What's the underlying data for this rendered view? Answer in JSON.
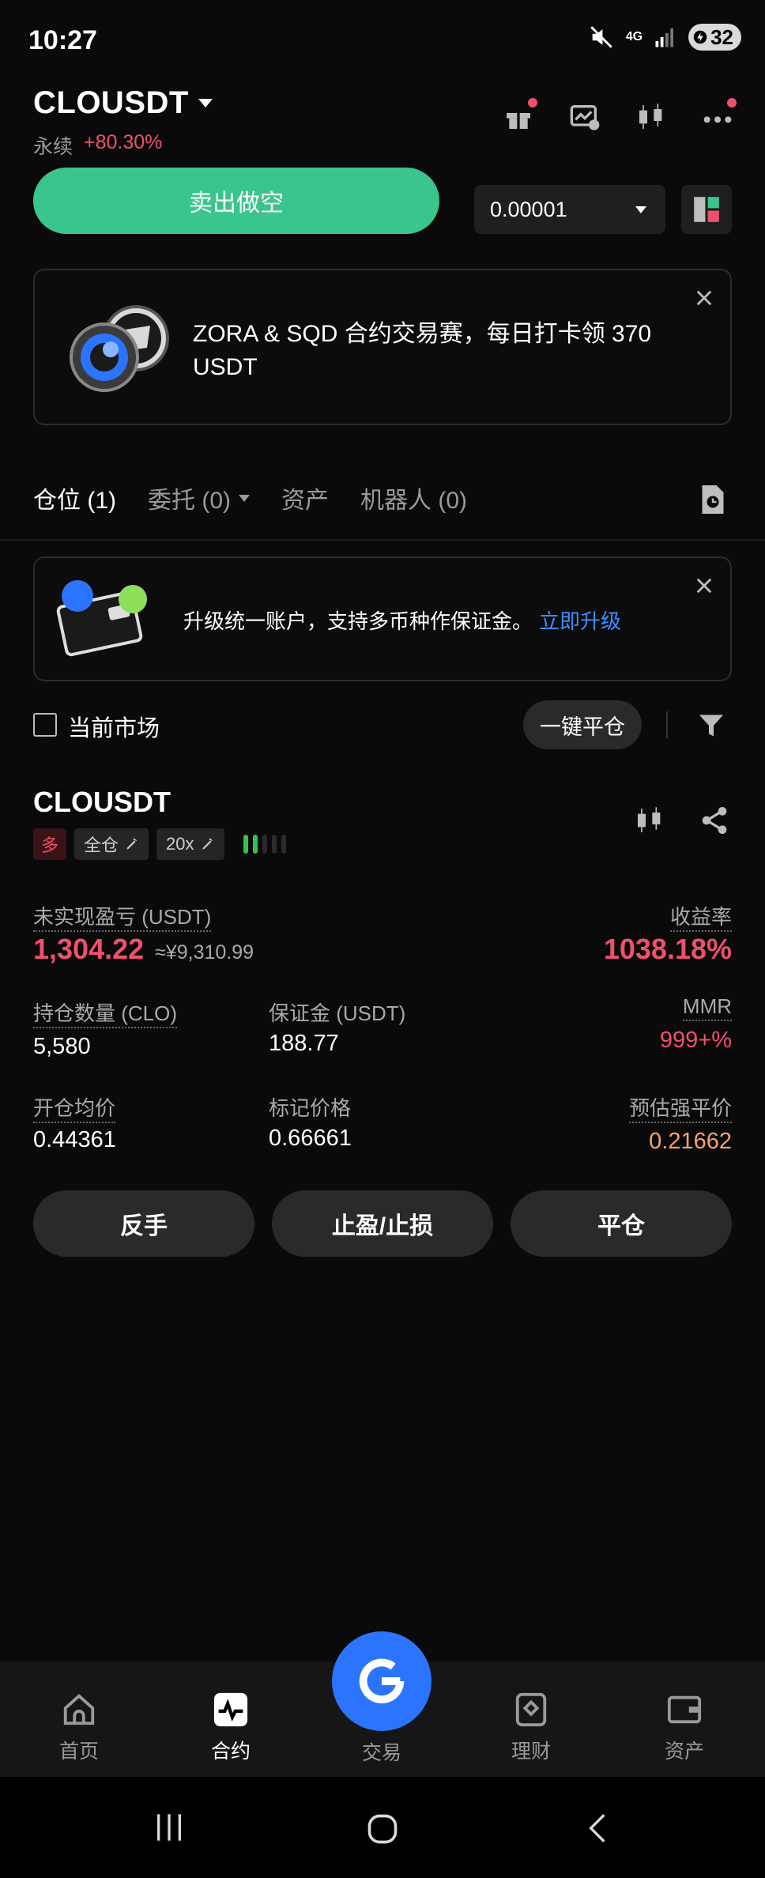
{
  "status_bar": {
    "time": "10:27",
    "network": "4G",
    "battery": "32"
  },
  "header": {
    "pair": "CLOUSDT",
    "type_label": "永续",
    "change": "+80.30%"
  },
  "order": {
    "sell_label": "卖出做空",
    "price_step": "0.00001"
  },
  "promo": {
    "text": "ZORA & SQD 合约交易赛，每日打卡领 370 USDT"
  },
  "tabs": [
    {
      "label": "仓位 (1)",
      "active": true
    },
    {
      "label": "委托 (0)",
      "dropdown": true
    },
    {
      "label": "资产"
    },
    {
      "label": "机器人 (0)"
    }
  ],
  "upgrade": {
    "text": "升级统一账户，支持多币种作保证金。",
    "link": "立即升级"
  },
  "filters": {
    "current_market_label": "当前市场",
    "close_all_label": "一键平仓"
  },
  "position": {
    "symbol": "CLOUSDT",
    "side_tag": "多",
    "margin_mode": "全仓",
    "leverage": "20x",
    "risk_level": 2,
    "pnl_label": "未实现盈亏 (USDT)",
    "pnl_value": "1,304.22",
    "pnl_cny": "≈¥9,310.99",
    "roi_label": "收益率",
    "roi_value": "1038.18%",
    "qty_label": "持仓数量 (CLO)",
    "qty_value": "5,580",
    "margin_label": "保证金 (USDT)",
    "margin_value": "188.77",
    "mmr_label": "MMR",
    "mmr_value": "999+%",
    "entry_label": "开仓均价",
    "entry_value": "0.44361",
    "mark_label": "标记价格",
    "mark_value": "0.66661",
    "liq_label": "预估强平价",
    "liq_value": "0.21662"
  },
  "actions": {
    "reverse": "反手",
    "tpsl": "止盈/止损",
    "close": "平仓"
  },
  "bottom_nav": [
    {
      "label": "首页",
      "icon": "home-icon"
    },
    {
      "label": "合约",
      "icon": "futures-icon",
      "active": true
    },
    {
      "label": "交易",
      "icon": "trade-icon"
    },
    {
      "label": "理财",
      "icon": "earn-icon"
    },
    {
      "label": "资产",
      "icon": "wallet-icon"
    }
  ],
  "colors": {
    "accent_green": "#3ac58d",
    "loss_red": "#f0506e",
    "link_blue": "#3f8cff",
    "liq_orange": "#f5a36a",
    "fab_blue": "#2a74ff"
  }
}
